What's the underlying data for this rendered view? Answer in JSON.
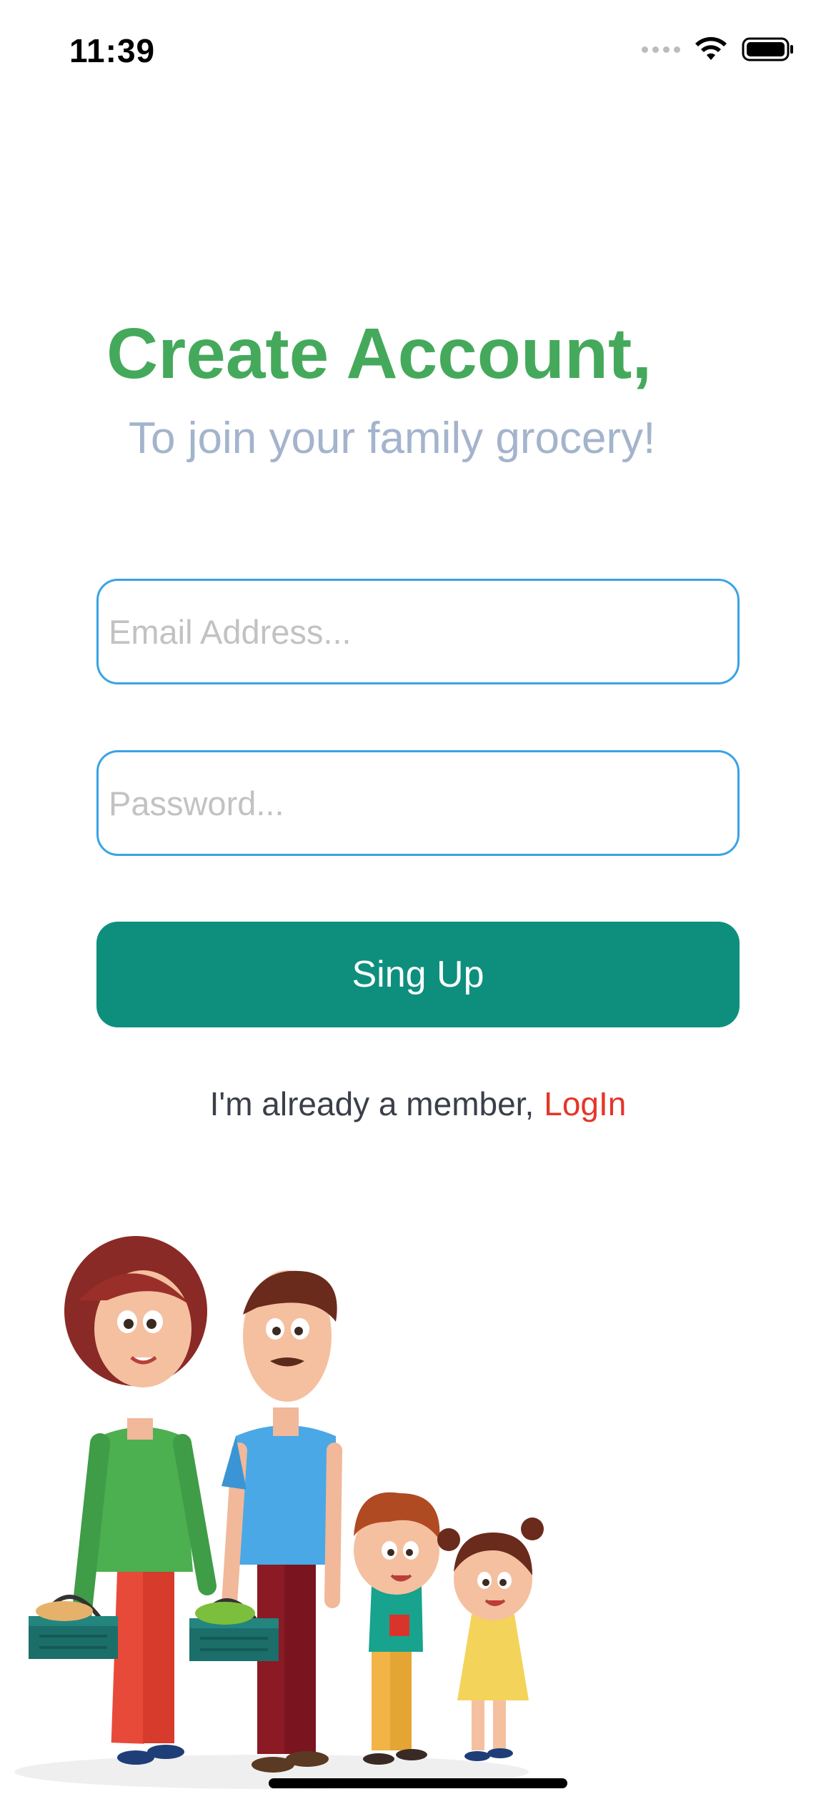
{
  "status_bar": {
    "time": "11:39",
    "icons": [
      "signal-dots-icon",
      "wifi-icon",
      "battery-icon"
    ]
  },
  "header": {
    "title": "Create Account,",
    "subtitle": "To join your family grocery!"
  },
  "form": {
    "email_placeholder": "Email Address...",
    "email_value": "",
    "password_placeholder": "Password...",
    "password_value": "",
    "signup_label": "Sing Up"
  },
  "footer": {
    "member_text": "I'm already a member,",
    "login_label": "LogIn"
  },
  "colors": {
    "title": "#45a95c",
    "subtitle": "#a3b4cc",
    "input_border": "#39a3e6",
    "button": "#0e8f7e",
    "login_link": "#e5352a"
  },
  "illustration": {
    "subject": "family-shopping-illustration"
  }
}
